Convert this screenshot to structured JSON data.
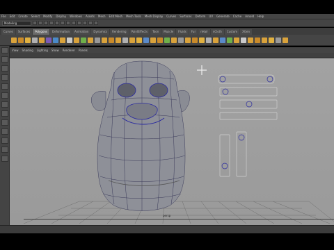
{
  "menubar": {
    "items": [
      "File",
      "Edit",
      "Create",
      "Select",
      "Modify",
      "Display",
      "Windows",
      "Assets",
      "Mesh",
      "Edit Mesh",
      "Mesh Tools",
      "Mesh Display",
      "Curves",
      "Surfaces",
      "Deform",
      "UV",
      "Generate",
      "Cache",
      "Arnold",
      "Help"
    ]
  },
  "statusline": {
    "mode": "Modeling"
  },
  "shelf": {
    "tabs": [
      "Curves",
      "Surfaces",
      "Polygons",
      "Deformation",
      "Animation",
      "Dynamics",
      "Rendering",
      "PaintEffects",
      "Toon",
      "Muscle",
      "Fluids",
      "Fur",
      "nHair",
      "nCloth",
      "Custom",
      "XGen"
    ],
    "active_index": 2,
    "icon_colors": [
      "#d9a23b",
      "#c98a2a",
      "#e0b040",
      "#b0b0b0",
      "#d9a23b",
      "#7a5ab8",
      "#4a8ac9",
      "#d9a23b",
      "#c9c9c9",
      "#d9a23b",
      "#6fb04a",
      "#d9a23b",
      "#999999",
      "#d9a23b",
      "#c98a2a",
      "#d9a23b",
      "#b0b0b0",
      "#d9a23b",
      "#e0b040",
      "#5a8ac9",
      "#d9a23b",
      "#c98a2a",
      "#6fb04a",
      "#d9a23b",
      "#999999",
      "#d9a23b",
      "#c98a2a",
      "#e0b040",
      "#b0b0b0",
      "#d9a23b",
      "#5a8ac9",
      "#6fb04a",
      "#d9a23b",
      "#c9c9c9",
      "#d9a23b",
      "#c98a2a",
      "#d9a23b",
      "#e0b040",
      "#999999",
      "#d9a23b"
    ]
  },
  "panel_menu": {
    "items": [
      "View",
      "Shading",
      "Lighting",
      "Show",
      "Renderer",
      "Panels"
    ]
  },
  "viewport": {
    "camera_label": "persp"
  },
  "toolbox": {
    "tool_icons": [
      "select-tool-icon",
      "lasso-tool-icon",
      "paint-select-icon",
      "move-tool-icon",
      "rotate-tool-icon",
      "scale-tool-icon",
      "last-tool-icon",
      "layout-single-icon",
      "layout-four-icon",
      "layout-side-icon",
      "layout-outliner-icon",
      "layout-graph-icon",
      "layout-uv-icon"
    ]
  },
  "colors": {
    "viewport_bg": "#9e9e9e",
    "mesh_fill": "#8c8e96",
    "wire": "#3a3a5a",
    "selection_blue": "#2a2aa0"
  }
}
